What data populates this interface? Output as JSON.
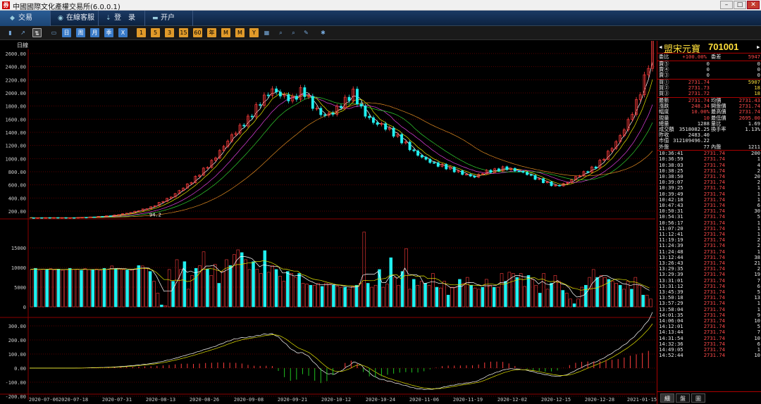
{
  "window": {
    "title": "中國國際文化產權交易所(6.0.0.1)"
  },
  "nav": {
    "tabs": [
      {
        "label": "交易",
        "icon": "trade-icon"
      },
      {
        "label": "在線客服",
        "icon": "chat-icon"
      },
      {
        "label": "登　录",
        "icon": "login-icon"
      },
      {
        "label": "开户",
        "icon": "account-icon"
      }
    ]
  },
  "toolbar": {
    "buttons": [
      "",
      "",
      "",
      "",
      "日",
      "周",
      "月",
      "季",
      "X",
      "1",
      "5",
      "3",
      "15",
      "60",
      "年",
      "M",
      "M",
      "Y",
      "",
      "",
      "",
      "",
      ""
    ]
  },
  "chart_labels": {
    "period": "日線",
    "low_marker": "94.2"
  },
  "chart_data": [
    {
      "type": "candlestick",
      "panel": "price",
      "ylim": [
        100,
        2600
      ],
      "yticks": [
        "2600.00",
        "2400.00",
        "2200.00",
        "2000.00",
        "1800.00",
        "1600.00",
        "1400.00",
        "1200.00",
        "1000.00",
        "800.00",
        "600.00",
        "400.00",
        "200.00"
      ],
      "x": [
        "2020-07-06",
        "2020-07-18",
        "2020-07-31",
        "2020-08-13",
        "2020-08-26",
        "2020-09-08",
        "2020-09-21",
        "2020-10-12",
        "2020-10-24",
        "2020-11-06",
        "2020-11-19",
        "2020-12-02",
        "2020-12-15",
        "2020-12-28",
        "2021-01-15"
      ],
      "close_trend": [
        [
          0,
          100
        ],
        [
          10,
          100
        ],
        [
          20,
          100
        ],
        [
          30,
          110
        ],
        [
          40,
          130
        ],
        [
          50,
          180
        ],
        [
          60,
          260
        ],
        [
          70,
          420
        ],
        [
          80,
          650
        ],
        [
          90,
          950
        ],
        [
          100,
          1350
        ],
        [
          108,
          1600
        ],
        [
          115,
          1900
        ],
        [
          120,
          2050
        ],
        [
          125,
          1950
        ],
        [
          130,
          1900
        ],
        [
          135,
          2050
        ],
        [
          140,
          1800
        ],
        [
          145,
          1650
        ],
        [
          150,
          1700
        ],
        [
          155,
          1850
        ],
        [
          160,
          2000
        ],
        [
          165,
          1700
        ],
        [
          170,
          1550
        ],
        [
          175,
          1500
        ],
        [
          180,
          1380
        ],
        [
          185,
          1250
        ],
        [
          190,
          1100
        ],
        [
          195,
          1000
        ],
        [
          200,
          920
        ],
        [
          205,
          880
        ],
        [
          210,
          820
        ],
        [
          215,
          760
        ],
        [
          220,
          720
        ],
        [
          225,
          800
        ],
        [
          230,
          820
        ],
        [
          235,
          860
        ],
        [
          240,
          820
        ],
        [
          245,
          780
        ],
        [
          250,
          700
        ],
        [
          255,
          640
        ],
        [
          260,
          580
        ],
        [
          265,
          620
        ],
        [
          270,
          720
        ],
        [
          275,
          800
        ],
        [
          280,
          880
        ],
        [
          285,
          1050
        ],
        [
          290,
          1250
        ],
        [
          295,
          1500
        ],
        [
          300,
          1850
        ],
        [
          305,
          2300
        ],
        [
          308,
          2731.74
        ]
      ]
    },
    {
      "type": "bar",
      "panel": "volume",
      "ylim": [
        0,
        17000
      ],
      "yticks": [
        "15000",
        "10000",
        "5000",
        "0"
      ],
      "values": [
        9500,
        9800,
        9300,
        9600,
        9500,
        9700,
        9400,
        9600,
        9300,
        9500,
        9800,
        9500,
        9600,
        9300,
        9700,
        9500,
        9400,
        9600,
        9300,
        9800,
        9500,
        10400,
        9700,
        9600,
        9500,
        9400,
        9300,
        9600,
        10500,
        10400,
        9800,
        9000,
        6500,
        3500,
        500,
        300,
        9500,
        6500,
        12000,
        9500,
        11500,
        4500,
        8000,
        9800,
        10500,
        14000,
        9600,
        8000,
        10800,
        6000,
        9000,
        12000,
        10500,
        13300,
        14500,
        13800,
        12000,
        9500,
        11500,
        9600,
        8500,
        14300,
        8800,
        10500,
        9500,
        7800,
        6500,
        9000,
        8500,
        7500,
        8500,
        6000,
        5800,
        5500,
        5500,
        6000,
        5200,
        6000,
        5800,
        5500,
        5300,
        5000,
        5000,
        4500,
        5200,
        5500,
        6000,
        19000,
        6000,
        5000,
        5500,
        9500,
        5000,
        5800,
        12500,
        7500,
        5500,
        9000,
        14800,
        4500,
        7000,
        5500,
        6500,
        6000,
        5500,
        8500,
        5000,
        4800,
        6500,
        3000,
        5000,
        5000,
        7000,
        6000,
        7500,
        5500,
        4800,
        4500,
        5000,
        7000,
        5500,
        5000,
        5000,
        8500,
        6500,
        8800,
        8500,
        7500,
        8500,
        5200,
        8000,
        7000,
        5500,
        3500,
        8500,
        4500,
        6000,
        8000,
        6500,
        4200,
        3500,
        2000,
        800,
        2000,
        5000,
        5500,
        7500,
        9500,
        7500,
        8000,
        7500,
        7000,
        6500,
        6000,
        5500,
        4500,
        6500,
        4500,
        7500,
        5500,
        3000,
        3000,
        2000
      ]
    },
    {
      "type": "line",
      "panel": "macd",
      "ylim": [
        -200,
        400
      ],
      "yticks": [
        "400.00",
        "300.00",
        "200.00",
        "100.00",
        "0.00",
        "-100.00",
        "-200.00"
      ]
    }
  ],
  "quote": {
    "name": "盟宋元寶",
    "code": "701001",
    "header_rows": [
      {
        "label": "委比",
        "value": "+100.00%",
        "label2": "委差",
        "value2": "5947",
        "value_color": "red",
        "value2_color": "red"
      }
    ],
    "sell_rows": [
      {
        "label": "賣⑤",
        "price": "0",
        "vol": "0"
      },
      {
        "label": "賣④",
        "price": "0",
        "vol": "0"
      },
      {
        "label": "賣③",
        "price": "0",
        "vol": "0"
      }
    ],
    "buy_rows": [
      {
        "label": "買①",
        "price": "2731.74",
        "vol": "5907"
      },
      {
        "label": "買②",
        "price": "2731.73",
        "vol": "18"
      },
      {
        "label": "買③",
        "price": "2731.72",
        "vol": "18"
      }
    ],
    "stat_rows": [
      {
        "l1": "最新",
        "v1": "2731.74",
        "l2": "均價",
        "v2": "2731.43"
      },
      {
        "l1": "漲跌",
        "v1": "248.34",
        "l2": "開盤價",
        "v2": "2731.74"
      },
      {
        "l1": "幅度",
        "v1": "10.00%",
        "l2": "最高價",
        "v2": "2731.74"
      },
      {
        "l1": "現量",
        "v1": "10",
        "l2": "最低價",
        "v2": "2695.00"
      },
      {
        "l1": "總量",
        "v1": "1288",
        "l2": "量比",
        "v2": "1.69"
      },
      {
        "l1": "成交額",
        "v1": "3518082.25",
        "l2": "換手率",
        "v2": "1.13%"
      },
      {
        "l1": "昨收",
        "v1": "2483.40",
        "l2": "",
        "v2": ""
      },
      {
        "l1": "市值",
        "v1": "312109496.22",
        "l2": "",
        "v2": ""
      },
      {
        "l1": "外盤",
        "v1": "77",
        "l2": "內盤",
        "v2": "1211"
      }
    ],
    "ticks": [
      {
        "time": "10:36:41",
        "price": "2731.74",
        "vol": "200"
      },
      {
        "time": "10:36:59",
        "price": "2731.74",
        "vol": "1"
      },
      {
        "time": "10:38:03",
        "price": "2731.74",
        "vol": "4"
      },
      {
        "time": "10:38:25",
        "price": "2731.74",
        "vol": "2"
      },
      {
        "time": "10:38:50",
        "price": "2731.74",
        "vol": "20"
      },
      {
        "time": "10:39:07",
        "price": "2731.74",
        "vol": "2"
      },
      {
        "time": "10:39:25",
        "price": "2731.74",
        "vol": "1"
      },
      {
        "time": "10:39:49",
        "price": "2731.74",
        "vol": "1"
      },
      {
        "time": "10:42:18",
        "price": "2731.74",
        "vol": "1"
      },
      {
        "time": "10:47:43",
        "price": "2731.74",
        "vol": "6"
      },
      {
        "time": "10:50:31",
        "price": "2731.74",
        "vol": "30"
      },
      {
        "time": "10:54:31",
        "price": "2731.74",
        "vol": "5"
      },
      {
        "time": "10:56:17",
        "price": "2731.74",
        "vol": "1"
      },
      {
        "time": "11:07:20",
        "price": "2731.74",
        "vol": "1"
      },
      {
        "time": "11:12:41",
        "price": "2731.74",
        "vol": "1"
      },
      {
        "time": "11:19:19",
        "price": "2731.74",
        "vol": "2"
      },
      {
        "time": "11:24:39",
        "price": "2731.74",
        "vol": "2"
      },
      {
        "time": "11:24:48",
        "price": "2731.74",
        "vol": "1"
      },
      {
        "time": "13:12:44",
        "price": "2731.74",
        "vol": "38"
      },
      {
        "time": "13:26:43",
        "price": "2731.74",
        "vol": "21"
      },
      {
        "time": "13:29:35",
        "price": "2731.74",
        "vol": "2"
      },
      {
        "time": "13:29:39",
        "price": "2731.74",
        "vol": "19"
      },
      {
        "time": "13:31:01",
        "price": "2731.74",
        "vol": "7"
      },
      {
        "time": "13:31:12",
        "price": "2731.74",
        "vol": "6"
      },
      {
        "time": "13:45:39",
        "price": "2731.74",
        "vol": "5"
      },
      {
        "time": "13:50:18",
        "price": "2731.74",
        "vol": "13"
      },
      {
        "time": "13:57:29",
        "price": "2731.74",
        "vol": "1"
      },
      {
        "time": "13:58:04",
        "price": "2731.74",
        "vol": "1"
      },
      {
        "time": "14:01:35",
        "price": "2731.74",
        "vol": "9"
      },
      {
        "time": "14:06:04",
        "price": "2731.74",
        "vol": "10"
      },
      {
        "time": "14:12:01",
        "price": "2731.74",
        "vol": "5"
      },
      {
        "time": "14:13:44",
        "price": "2731.74",
        "vol": "7"
      },
      {
        "time": "14:31:54",
        "price": "2731.74",
        "vol": "10"
      },
      {
        "time": "14:32:36",
        "price": "2731.74",
        "vol": "6"
      },
      {
        "time": "14:49:05",
        "price": "2731.74",
        "vol": "1"
      },
      {
        "time": "14:52:44",
        "price": "2731.74",
        "vol": "10"
      }
    ],
    "bottom_tabs": [
      "細",
      "盤",
      "圖"
    ]
  },
  "colors": {
    "up": "#ff3c3c",
    "down": "#20f0f0",
    "grid": "#8b0000",
    "ma5": "#ffffff",
    "ma10": "#e6e600",
    "ma20": "#e040e0",
    "ma30": "#30d030",
    "ma60": "#e08a20"
  }
}
